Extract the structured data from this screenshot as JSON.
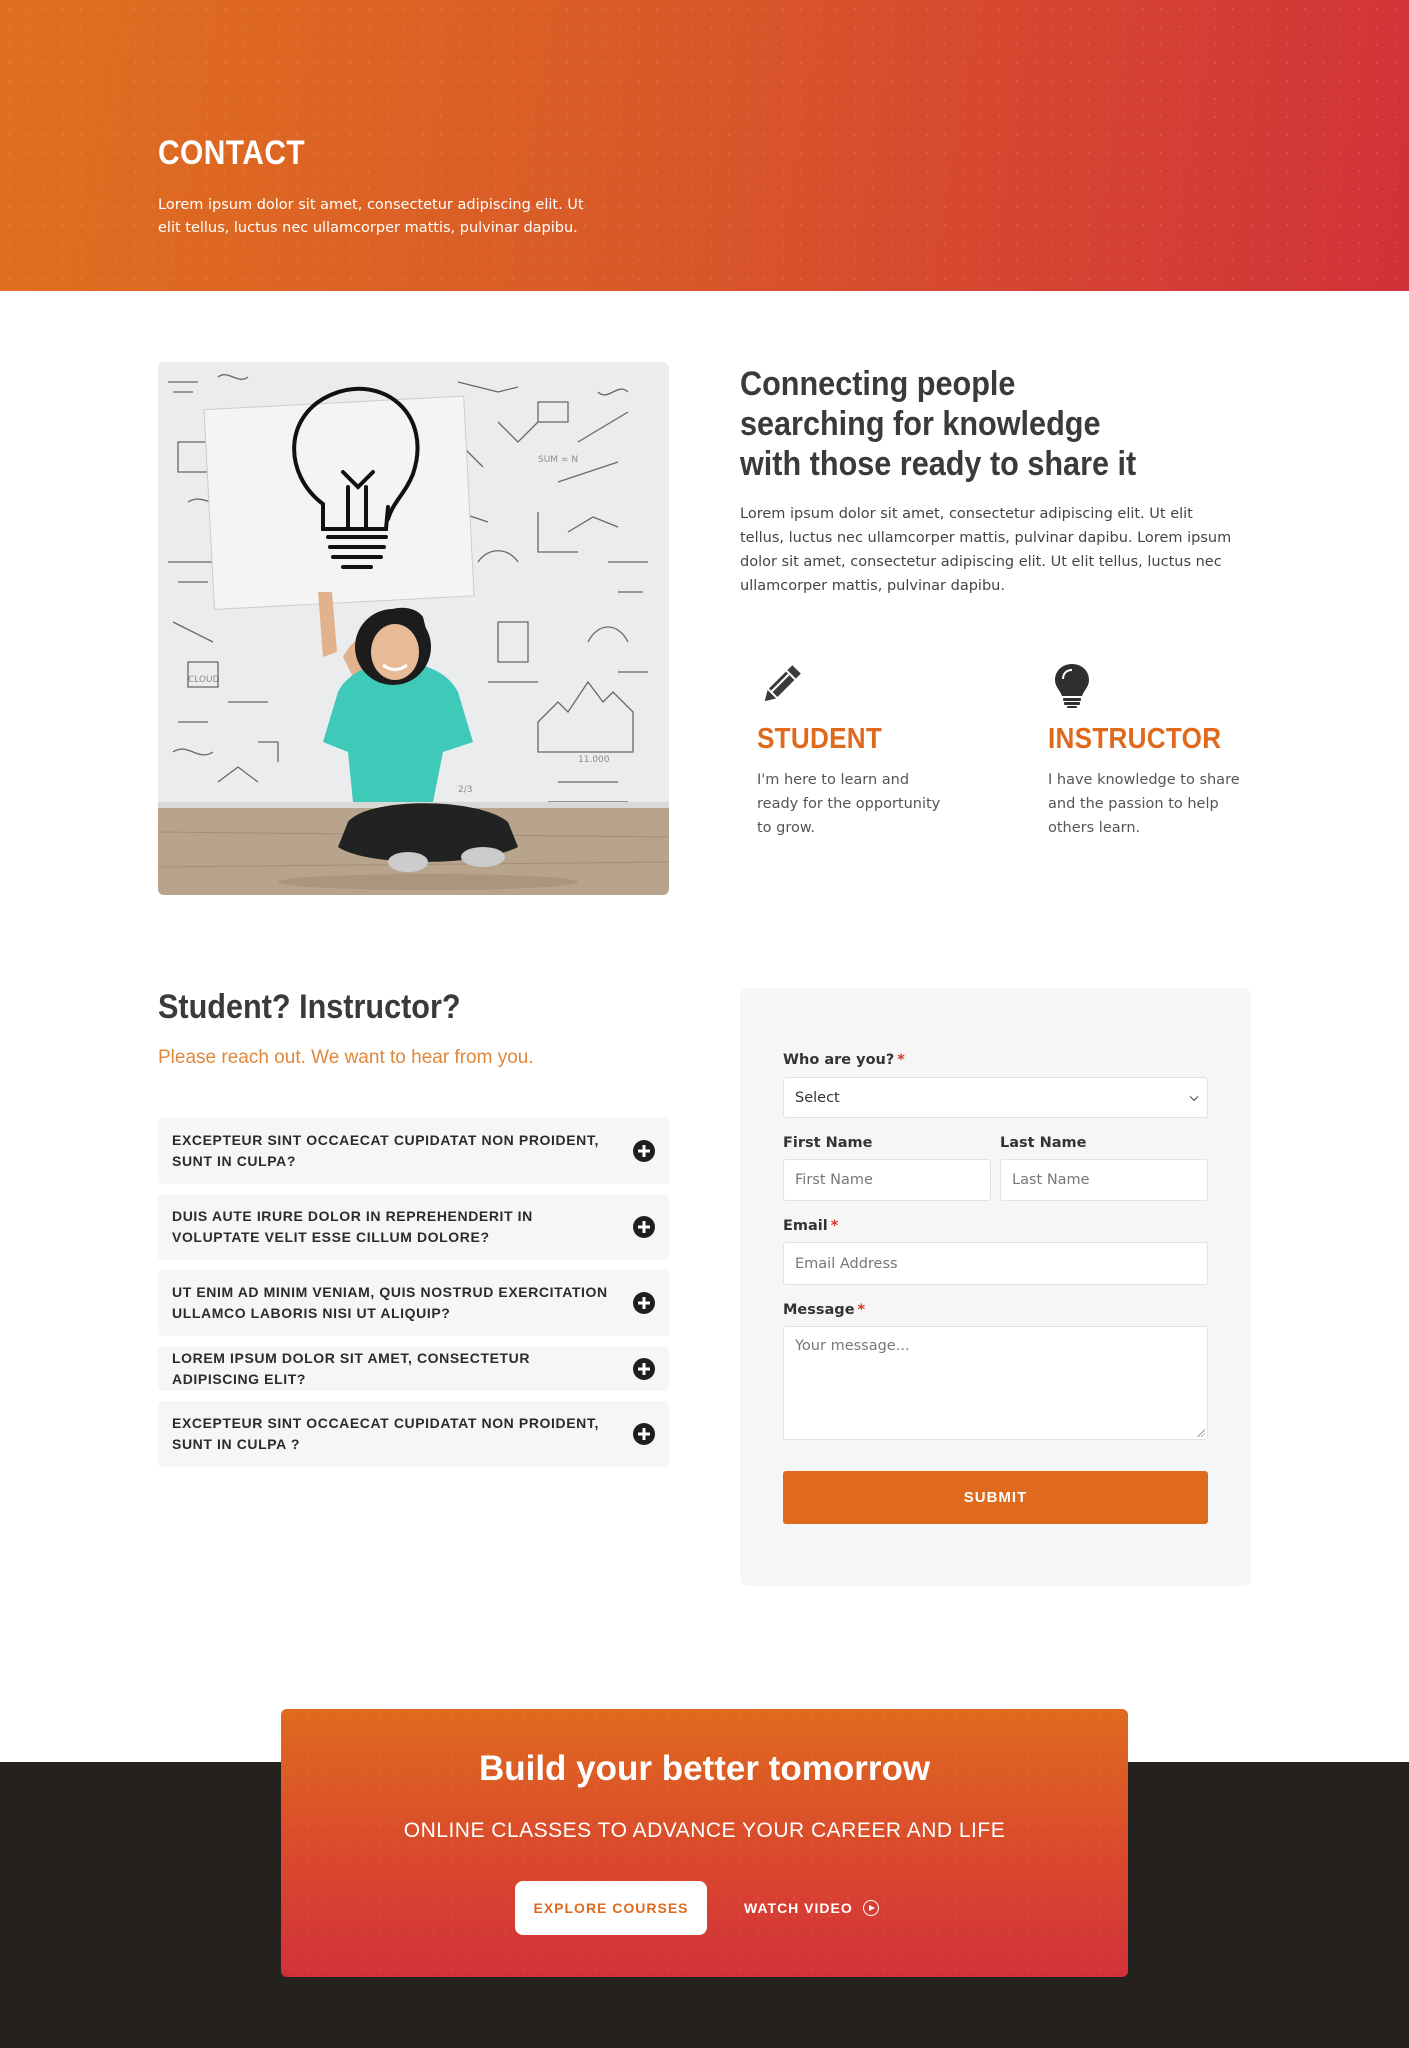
{
  "hero": {
    "title": "CONTACT",
    "text": "Lorem ipsum dolor sit amet, consectetur adipiscing elit. Ut elit tellus, luctus nec ullamcorper mattis, pulvinar dapibu."
  },
  "intro": {
    "title": "Connecting people searching for knowledge with those ready to share it",
    "text": "Lorem ipsum dolor sit amet, consectetur adipiscing elit. Ut elit tellus, luctus nec ullamcorper mattis, pulvinar dapibu. Lorem ipsum dolor sit amet, consectetur adipiscing elit. Ut elit tellus, luctus nec ullamcorper mattis, pulvinar dapibu."
  },
  "roles": [
    {
      "icon": "pencil-icon",
      "title": "STUDENT",
      "text": "I'm here to learn and ready for the opportunity to grow."
    },
    {
      "icon": "lightbulb-icon",
      "title": "INSTRUCTOR",
      "text": "I have knowledge to share and the passion to help others learn."
    }
  ],
  "faq": {
    "title": "Student? Instructor?",
    "subtitle": "Please reach out. We want to hear from you.",
    "items": [
      "EXCEPTEUR SINT OCCAECAT CUPIDATAT NON PROIDENT, SUNT IN CULPA?",
      "DUIS AUTE IRURE DOLOR IN REPREHENDERIT IN VOLUPTATE VELIT ESSE CILLUM DOLORE?",
      "UT ENIM AD MINIM VENIAM, QUIS NOSTRUD EXERCITATION ULLAMCO LABORIS NISI UT ALIQUIP?",
      "LOREM IPSUM DOLOR SIT AMET, CONSECTETUR ADIPISCING ELIT?",
      "EXCEPTEUR SINT OCCAECAT CUPIDATAT NON PROIDENT, SUNT IN CULPA ?"
    ]
  },
  "form": {
    "who_label": "Who are you?",
    "who_value": "Select",
    "first_label": "First Name",
    "first_placeholder": "First Name",
    "last_label": "Last Name",
    "last_placeholder": "Last Name",
    "email_label": "Email",
    "email_placeholder": "Email Address",
    "message_label": "Message",
    "message_placeholder": "Your message...",
    "required_mark": "*",
    "submit": "SUBMIT"
  },
  "cta": {
    "title": "Build your better tomorrow",
    "subtitle": "ONLINE CLASSES TO ADVANCE YOUR CAREER AND LIFE",
    "explore": "EXPLORE COURSES",
    "watch": "WATCH VIDEO"
  },
  "colors": {
    "accent": "#df6a1e",
    "hero_gradient_end": "#d1313a",
    "dark": "#24211f"
  }
}
